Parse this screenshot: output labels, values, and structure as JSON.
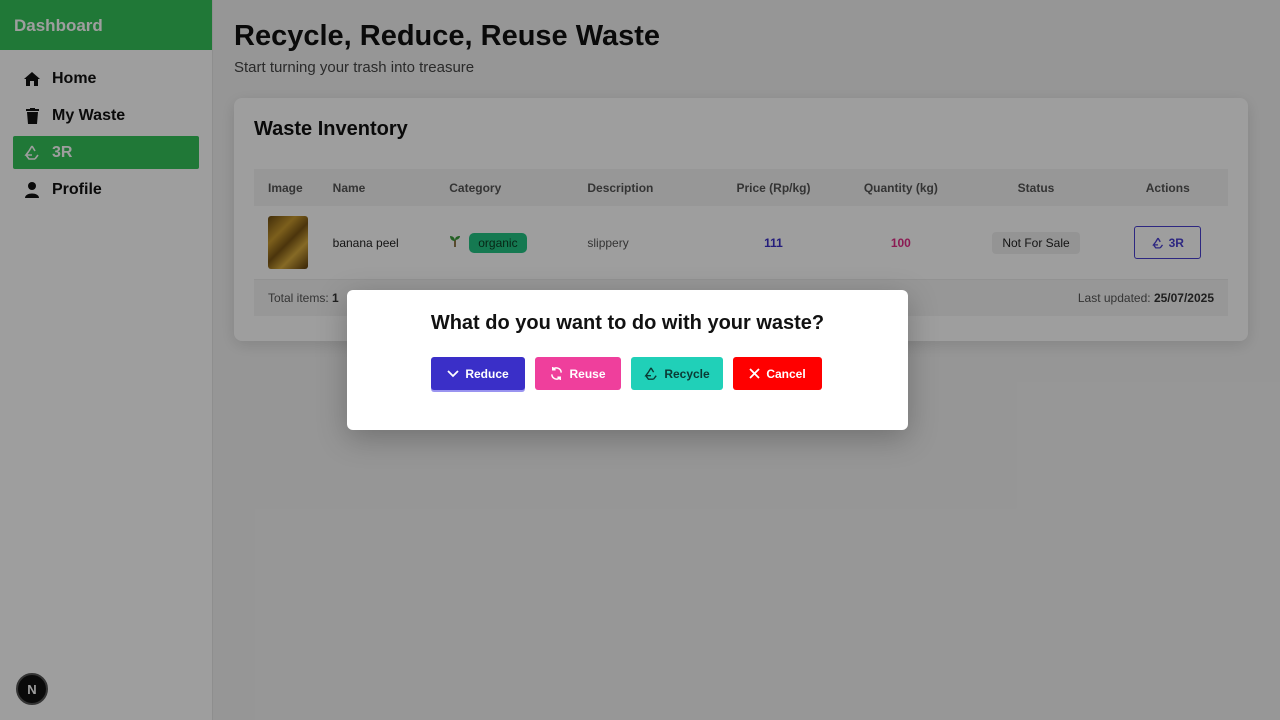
{
  "sidebar": {
    "brand": "Dashboard",
    "items": [
      {
        "label": "Home",
        "icon": "home-icon"
      },
      {
        "label": "My Waste",
        "icon": "trash-icon"
      },
      {
        "label": "3R",
        "icon": "recycle-icon",
        "active": true
      },
      {
        "label": "Profile",
        "icon": "user-icon"
      }
    ],
    "badge": "N"
  },
  "header": {
    "title": "Recycle, Reduce, Reuse Waste",
    "subtitle": "Start turning your trash into treasure"
  },
  "inventory": {
    "title": "Waste Inventory",
    "columns": [
      "Image",
      "Name",
      "Category",
      "Description",
      "Price (Rp/kg)",
      "Quantity (kg)",
      "Status",
      "Actions"
    ],
    "rows": [
      {
        "name": "banana peel",
        "category": "organic",
        "description": "slippery",
        "price": "111",
        "quantity": "100",
        "status": "Not For Sale",
        "action_label": "3R"
      }
    ],
    "footer": {
      "total_label": "Total items:",
      "total_value": "1",
      "updated_label": "Last updated:",
      "updated_value": "25/07/2025"
    }
  },
  "modal": {
    "title": "What do you want to do with your waste?",
    "buttons": {
      "reduce": "Reduce",
      "reuse": "Reuse",
      "recycle": "Recycle",
      "cancel": "Cancel"
    }
  },
  "colors": {
    "brand_green": "#34c25a",
    "reduce": "#3a2fc8",
    "reuse": "#ef3f9c",
    "recycle": "#20d0b8",
    "cancel": "#ff0000"
  }
}
